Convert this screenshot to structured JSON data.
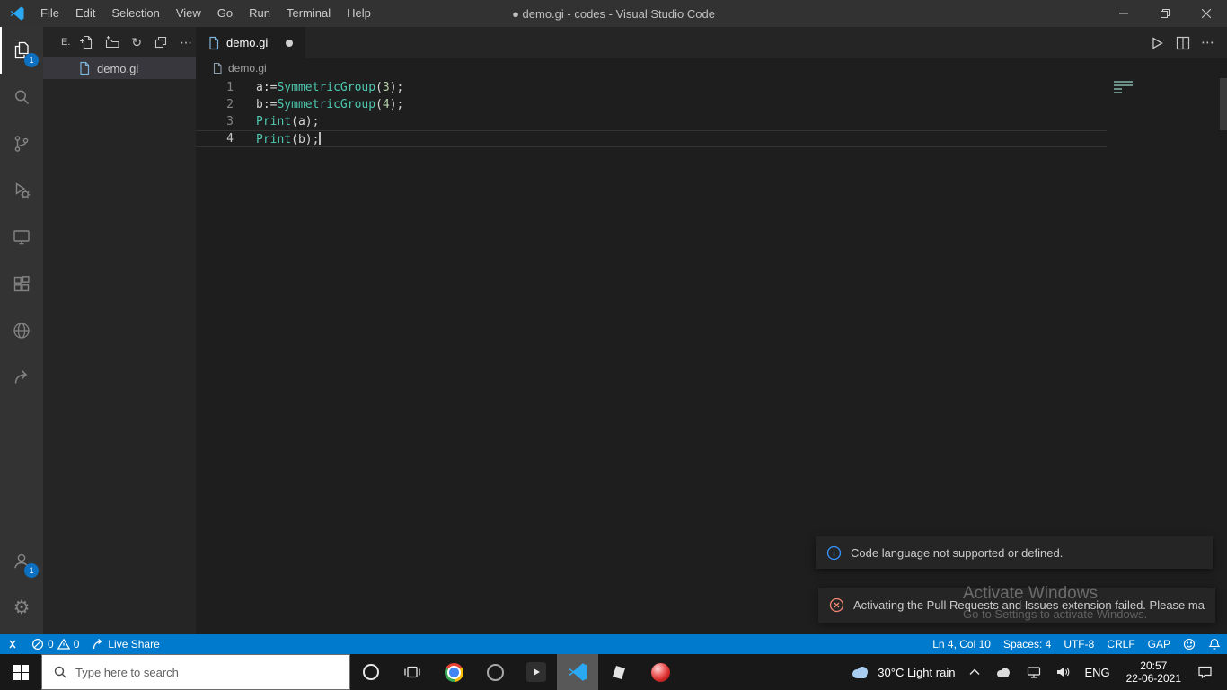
{
  "window": {
    "title": "● demo.gi - codes - Visual Studio Code"
  },
  "menu_bar": {
    "items": [
      "File",
      "Edit",
      "Selection",
      "View",
      "Go",
      "Run",
      "Terminal",
      "Help"
    ]
  },
  "activity_bar": {
    "explorer_badge": "1",
    "accounts_badge": "1"
  },
  "sidebar": {
    "header_label": "E.",
    "file_name": "demo.gi"
  },
  "editor": {
    "tab_label": "demo.gi",
    "breadcrumb": "demo.gi",
    "lines": [
      {
        "num": "1",
        "tokens": [
          {
            "t": "a:=",
            "c": "plain"
          },
          {
            "t": "SymmetricGroup",
            "c": "func"
          },
          {
            "t": "(",
            "c": "plain"
          },
          {
            "t": "3",
            "c": "num"
          },
          {
            "t": ");",
            "c": "plain"
          }
        ]
      },
      {
        "num": "2",
        "tokens": [
          {
            "t": "b:=",
            "c": "plain"
          },
          {
            "t": "SymmetricGroup",
            "c": "func"
          },
          {
            "t": "(",
            "c": "plain"
          },
          {
            "t": "4",
            "c": "num"
          },
          {
            "t": ");",
            "c": "plain"
          }
        ]
      },
      {
        "num": "3",
        "tokens": [
          {
            "t": "Print",
            "c": "func"
          },
          {
            "t": "(a);",
            "c": "plain"
          }
        ]
      },
      {
        "num": "4",
        "tokens": [
          {
            "t": "Print",
            "c": "func"
          },
          {
            "t": "(b);",
            "c": "plain"
          }
        ]
      }
    ]
  },
  "notifications": [
    {
      "kind": "info",
      "message": "Code language not supported or defined."
    },
    {
      "kind": "error",
      "message": "Activating the Pull Requests and Issues extension failed. Please make s..."
    }
  ],
  "watermark": {
    "line1": "Activate Windows",
    "line2": "Go to Settings to activate Windows."
  },
  "status_bar": {
    "errors": "0",
    "warnings": "0",
    "live_share": "Live Share",
    "cursor_position": "Ln 4, Col 10",
    "indentation": "Spaces: 4",
    "encoding": "UTF-8",
    "eol": "CRLF",
    "language_mode": "GAP"
  },
  "taskbar": {
    "search_placeholder": "Type here to search",
    "weather": "30°C Light rain",
    "input_language": "ENG",
    "time": "20:57",
    "date": "22-06-2021"
  },
  "colors": {
    "status_bar": "#007acc",
    "func": "#4ec9b0",
    "number": "#b5cea8",
    "badge": "#0e70c0"
  }
}
